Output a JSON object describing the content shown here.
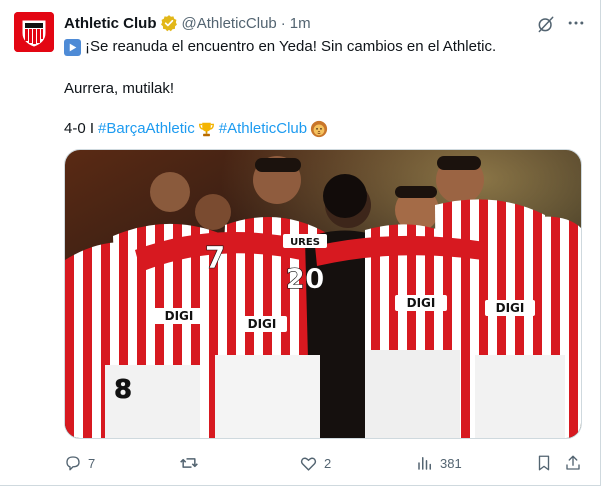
{
  "tweet": {
    "author_name": "Athletic Club",
    "handle": "@AthleticClub",
    "separator": "·",
    "time": "1m",
    "line1": "¡Se reanuda el encuentro en Yeda! Sin cambios en el Athletic.",
    "line2": "Aurrera, mutilak!",
    "score": "4-0 I",
    "hashtag1": "#BarçaAthletic",
    "hashtag2": "#AthleticClub",
    "image_alt": "",
    "jersey_texts": [
      "DIGI",
      "DIGI",
      "DIGI",
      "DIGI",
      "DIGI"
    ],
    "shirt_names": [
      "URES"
    ],
    "shirt_numbers": [
      "7",
      "8",
      "20"
    ]
  },
  "actions": {
    "replies": "7",
    "reposts": "",
    "likes": "2",
    "views": "381"
  },
  "colors": {
    "accent": "#1d9bf0",
    "club_red": "#e30613",
    "secondary_text": "#536471",
    "verified_gold": "#e2b719"
  },
  "icons": {
    "avatar": "athletic-club-crest",
    "badge": "verified-gold-badge",
    "grok": "grok-icon",
    "more": "more-icon",
    "play": "play-button-emoji",
    "trophy": "trophy-emoji",
    "lion": "lion-emoji",
    "reply": "reply-icon",
    "repost": "repost-icon",
    "like": "heart-icon",
    "views": "views-icon",
    "bookmark": "bookmark-icon",
    "share": "share-icon"
  }
}
